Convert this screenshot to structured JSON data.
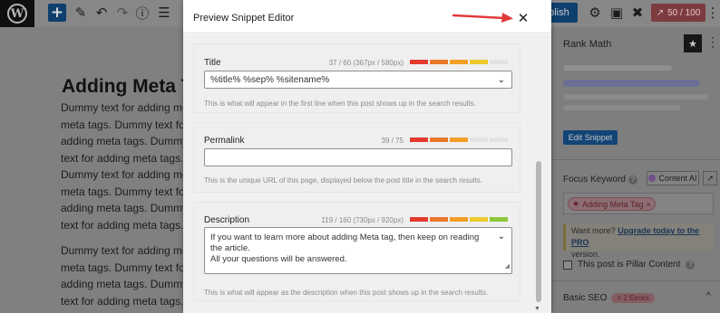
{
  "toolbar": {
    "wp_logo_letter": "W",
    "add_icon": "+",
    "edit_icon": "✎",
    "undo_icon": "↶",
    "redo_icon": "↷",
    "info_icon": "ⓘ",
    "list_icon": "☰",
    "publish_label": "ublish",
    "settings_icon": "⚙",
    "preview_icon": "▣",
    "rankmath_icon": "✖",
    "score_label": "50 / 100",
    "score_icon": "↗",
    "more_icon": "⋮"
  },
  "editor": {
    "post_title": "Adding Meta T",
    "paragraph1": [
      "Dummy text for adding met",
      "meta tags. Dummy text for",
      "adding meta tags. Dummy t",
      "text for adding meta tags. D",
      "Dummy text for adding met",
      "meta tags. Dummy text for",
      "adding meta tags. Dummy t",
      "text for adding meta tags. D"
    ],
    "paragraph2": [
      "Dummy text for adding met",
      "meta tags. Dummy text for",
      "adding meta tags. Dummy t",
      "text for adding meta tags. D"
    ]
  },
  "modal": {
    "title": "Preview Snippet Editor",
    "close_icon": "✕",
    "sections": {
      "title": {
        "label": "Title",
        "count": "37 / 60 (367px / 580px)",
        "value": "%title% %sep% %sitename%",
        "chevron": "⌄",
        "help": "This is what will appear in the first line when this post shows up in the search results.",
        "meter_fill": 0.62,
        "meter_colors": [
          "#e33a2d",
          "#e8782a",
          "#f19f27",
          "#eec92b",
          "#e2e2e2"
        ]
      },
      "permalink": {
        "label": "Permalink",
        "count": "39 / 75",
        "value": "",
        "help": "This is the unique URL of this page, displayed below the post title in the search results.",
        "meter_fill": 0.52,
        "meter_colors": [
          "#e33a2d",
          "#e8782a",
          "#f19f27",
          "#e2e2e2",
          "#e2e2e2"
        ]
      },
      "description": {
        "label": "Description",
        "count": "119 / 160 (730px / 920px)",
        "value_line1": "If you want to learn more about adding Meta tag, then keep on reading the article.",
        "value_line2": "All your questions will be answered.",
        "chevron": "⌄",
        "help": "This is what will appear as the description when this post shows up in the search results.",
        "meter_fill": 0.74,
        "meter_colors": [
          "#e33a2d",
          "#e8782a",
          "#f19f27",
          "#eec92b",
          "#8cc83b"
        ]
      }
    }
  },
  "sidebar": {
    "title": "Rank Math",
    "star_icon": "★",
    "more_icon": "⋮",
    "edit_snippet_label": "Edit Snippet",
    "focus_keyword_label": "Focus Keyword",
    "help_icon": "?",
    "content_ai_label": "Content AI",
    "trend_icon": "↗",
    "keyword_tag": "Adding Meta Tag",
    "keyword_star": "★",
    "keyword_remove": "×",
    "upgrade_prefix": "Want more? ",
    "upgrade_link": "Upgrade today to the PRO",
    "upgrade_suffix": "version.",
    "pillar_label": "This post is Pillar Content",
    "basic_seo_label": "Basic SEO",
    "errors_badge": "× 2 Errors",
    "collapse_icon": "^"
  }
}
